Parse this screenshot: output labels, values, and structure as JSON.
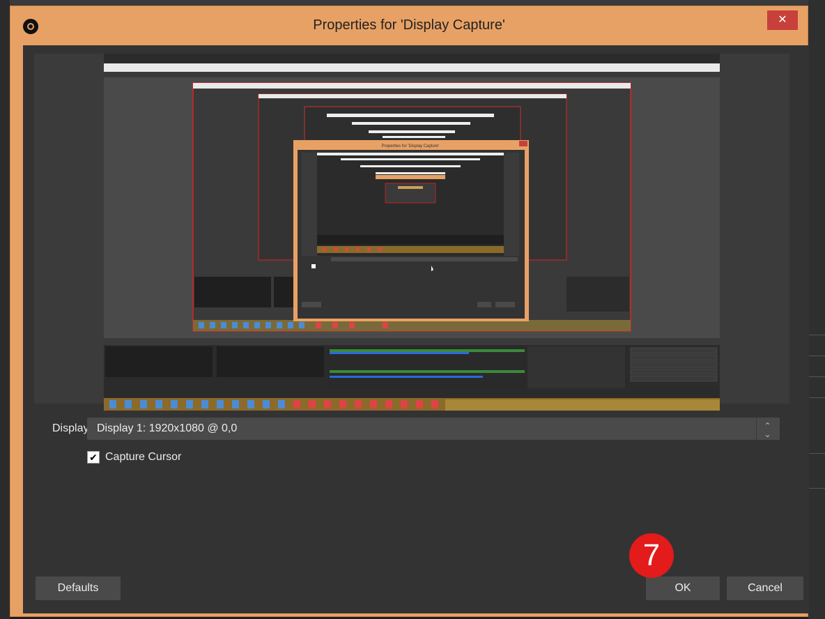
{
  "dialog": {
    "title": "Properties for 'Display Capture'",
    "close_glyph": "✕",
    "app_icon": "obs-logo-icon"
  },
  "preview": {
    "nested_dialog_title": "Properties for 'Display Capture'"
  },
  "display": {
    "label": "Display",
    "value": "Display 1: 1920x1080 @ 0,0",
    "spinner_up": "⌃",
    "spinner_down": "⌄"
  },
  "capture_cursor": {
    "label": "Capture Cursor",
    "checked": true,
    "check_glyph": "✔"
  },
  "buttons": {
    "defaults": "Defaults",
    "ok": "OK",
    "cancel": "Cancel"
  },
  "annotation": {
    "step_number": "7"
  },
  "colors": {
    "frame": "#e8a165",
    "client_bg": "#333333",
    "close_button": "#c7403b",
    "step_badge": "#e31b1b"
  }
}
